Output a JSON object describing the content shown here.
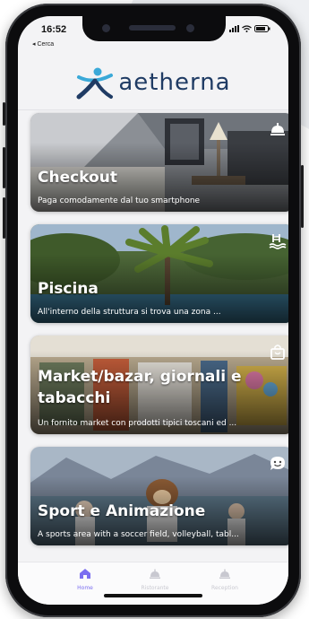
{
  "status_bar": {
    "time": "16:52",
    "back_label": "◂ Cerca"
  },
  "brand": {
    "name": "aetherna"
  },
  "cards": [
    {
      "title": "Checkout",
      "subtitle": "Paga comodamente dal tuo smartphone",
      "icon": "concierge-bell-icon"
    },
    {
      "title": "Piscina",
      "subtitle": "All'interno della struttura si trova una zona ...",
      "icon": "swimming-pool-icon"
    },
    {
      "title": "Market/bazar, giornali e tabacchi",
      "subtitle": "Un fornito market con prodotti tipici toscani ed ...",
      "icon": "shopping-bag-icon"
    },
    {
      "title": "Sport e Animazione",
      "subtitle": "A sports area with a soccer field, volleyball, tabl...",
      "icon": "chat-smile-icon"
    }
  ],
  "tabbar": {
    "items": [
      {
        "label": "Home",
        "icon": "home-icon",
        "active": true
      },
      {
        "label": "Ristorante",
        "icon": "restaurant-icon",
        "active": false
      },
      {
        "label": "Reception",
        "icon": "reception-bell-icon",
        "active": false
      }
    ]
  },
  "colors": {
    "accent": "#7b6ef0",
    "brand_blue": "#1f3b64",
    "brand_cyan": "#3aa9d8"
  }
}
